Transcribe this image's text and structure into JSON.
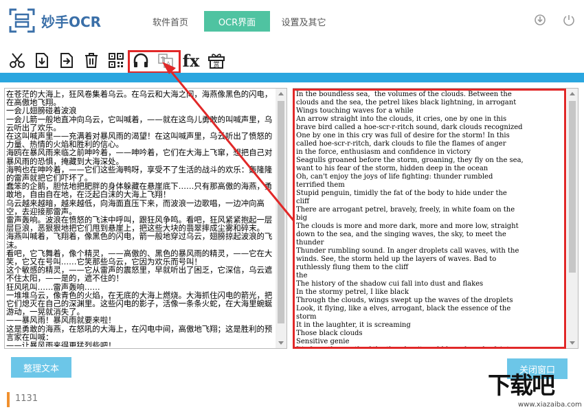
{
  "header": {
    "app_title": "妙手OCR",
    "tabs": [
      {
        "label": "软件首页",
        "active": false
      },
      {
        "label": "OCR界面",
        "active": true
      },
      {
        "label": "设置及其它",
        "active": false
      }
    ]
  },
  "colors": {
    "accent_green": "#4fc3a1",
    "accent_blue": "#2aa6df",
    "highlight_red": "#e12828",
    "button_blue": "#6cc6e8"
  },
  "toolbar": {
    "icons": [
      "scissors-icon",
      "import-icon",
      "export-icon",
      "delete-icon",
      "qrcode-icon",
      "headphones-icon",
      "translate-icon",
      "formula-icon",
      "gift-icon"
    ],
    "fx_label": "fx",
    "gift_label": "赏",
    "translate_label": "A"
  },
  "left_pane": {
    "text": "在苍茫的大海上，狂风卷集着乌云。在乌云和大海之间，海燕像黑色的闪电，在高傲地飞翔。\n一会儿翅膀碰着波浪\n一会儿箭一般地直冲向乌云，它叫喊着，——就在这鸟儿勇敢的叫喊声里，乌云听出了欢乐。\n在这叫喊声里——充满着对暴风雨的渴望！在这叫喊声里，乌云听出了愤怒的力量、热情的火焰和胜利的信心。\n海鸥在暴风雨来临之前呻吟着，——呻吟着，它们在大海上飞窜，想把自己对暴风雨的恐惧，掩藏到大海深处。\n海鸭也在呻吟着，——它们这些海鸭呀，享受不了生活的战斗的欢乐：轰隆隆的雷声就把它们吓坏了。\n蠢笨的企鹅，胆怯地把肥胖的身体躲藏在悬崖底下……只有那高傲的海燕，勇敢地，自由自在地，在泛起白沫的大海上飞翔！\n乌云越来越暗，越来越低，向海面直压下来，而波浪一边歌唱，一边冲向高空，去迎接那雷声。\n雷声轰响。波浪在愤怒的飞沫中呼叫，跟狂风争鸣。看吧，狂风紧紧抱起一层层巨浪，恶狠狠地把它们甩到悬崖上，把这些大块的翡翠摔成尘雾和碎末。\n海燕叫喊着，飞翔着，像黑色的闪电，箭一般地穿过乌云，翅膀掠起波浪的飞沫。\n看吧，它飞舞着，像个精灵，——高傲的、黑色的暴风雨的精灵，——它在大笑，它又在号叫……它笑那些乌云，它因为欢乐而号叫！\n这个敏感的精灵，——它从雷声的震怒里，早就听出了困乏，它深信，乌云遮不住太阳，——是的，遮不住的！\n狂风吼叫……雷声轰响……\n一堆堆乌云，像青色的火焰，在无底的大海上燃烧。大海抓住闪电的箭光，把它们熄灭在自己的深渊里。这些闪电的影子，活像一条条火蛇，在大海里蜿蜒游动，一晃就消失了。\n——暴风雨！暴风雨就要来啦！\n这是勇敢的海燕，在怒吼的大海上，在闪电中间，高傲地飞翔；这是胜利的预言家在叫喊：\n——让暴风雨来得更猛烈些吧！"
  },
  "right_pane": {
    "text": "In the boundless sea,  the volumes of the clouds. Between the\nclouds and the sea, the petrel likes black lightning, in arrogant\nWings touching waves for a while\nAn arrow straight into the clouds, it cries, one by one in this\nbrave bird called a hoe-scr-r-ritch sound, dark clouds recognized\nOne by one in this cry was full of desire for the storm! In this\ncalled hoe-scr-r-ritch, dark clouds to file the flames of anger\nin the force, enthusiasm and confidence in victory\nSeagulls groaned before the storm, groaning, they fly on the sea,\nwant to his fear of the storm, hidden deep in the ocean\nOh, can't enjoy the joys of life fighting: thunder rumbled\nterrified them\nStupid penguin, timidly the fat of the body to hide under the\ncliff\nThere are arrogant petrel, bravely, freely, in white foam on the\nbig\nThe clouds is more and more dark, more and more low, straight\ndown to the sea, and the singing waves, the sky, to meet the\nthunder\nThunder rumbling sound. In anger droplets call waves, with the\nwinds. See, the storm held up the layers of waves. Bad to\nruthlessly flung them to the cliff\nthe\nThe history of the shadow cui fall into dust and flakes\nIn the stormy petrel, I like black\nThrough the clouds, wings swept up the waves of the droplets\nLook, it flying, like a elves, arrogant, black the essence of the\nstorm\nIt in the laughter, it is screaming\nThose black clouds\nSensitive genie\nIt's from the wrath of the thunder, it could have heard a faint"
  },
  "buttons": {
    "clean_text": "整理文本",
    "close_window": "关闭窗口"
  },
  "status": {
    "char_count": "1131"
  },
  "watermark": {
    "big": "下载吧",
    "small": "www.xiazaiba.com"
  }
}
